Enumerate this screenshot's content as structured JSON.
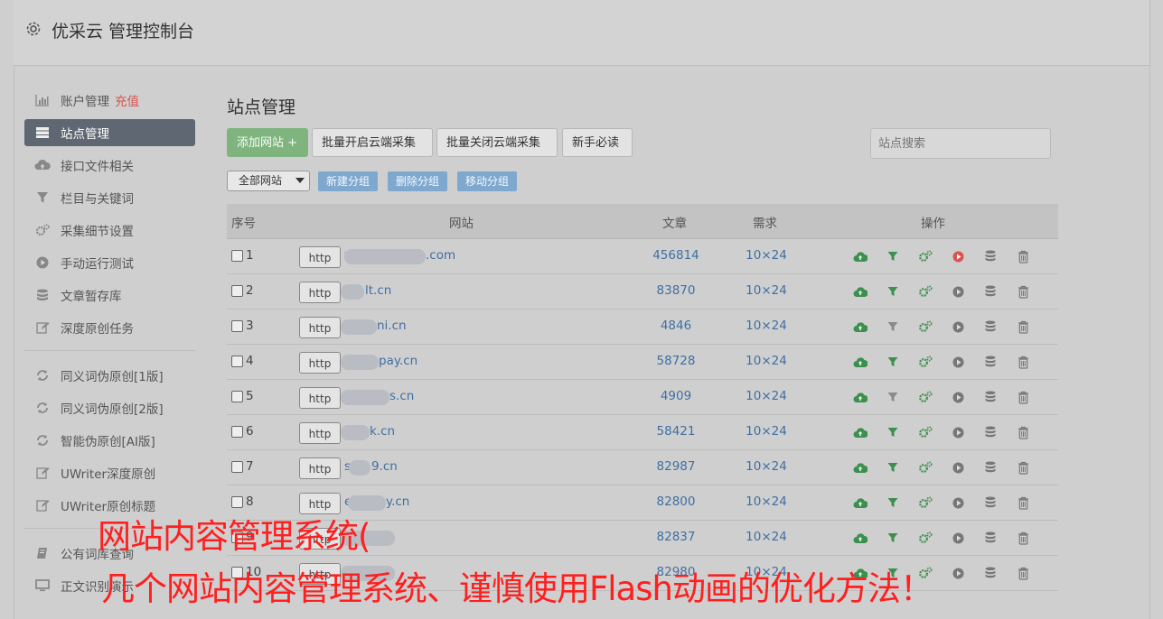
{
  "header": {
    "title": "优采云 管理控制台",
    "icon": "gear-icon"
  },
  "sidebar": {
    "items": [
      {
        "label": "账户管理",
        "extra": "充值",
        "icon": "bar-chart-icon",
        "active": false
      },
      {
        "label": "站点管理",
        "icon": "server-icon",
        "active": true
      },
      {
        "label": "接口文件相关",
        "icon": "cloud-upload-icon",
        "active": false
      },
      {
        "label": "栏目与关键词",
        "icon": "filter-icon",
        "active": false
      },
      {
        "label": "采集细节设置",
        "icon": "gears-icon",
        "active": false
      },
      {
        "label": "手动运行测试",
        "icon": "play-circle-icon",
        "active": false
      },
      {
        "label": "文章暂存库",
        "icon": "database-icon",
        "active": false
      },
      {
        "label": "深度原创任务",
        "icon": "edit-icon",
        "active": false
      }
    ],
    "items2": [
      {
        "label": "同义词伪原创[1版]",
        "icon": "refresh-icon"
      },
      {
        "label": "同义词伪原创[2版]",
        "icon": "refresh-icon"
      },
      {
        "label": "智能伪原创[AI版]",
        "icon": "refresh-icon"
      },
      {
        "label": "UWriter深度原创",
        "icon": "edit-icon"
      },
      {
        "label": "UWriter原创标题",
        "icon": "edit-icon"
      }
    ],
    "items3": [
      {
        "label": "公有词库查询",
        "icon": "book-icon"
      },
      {
        "label": "正文识别演示",
        "icon": "monitor-icon"
      }
    ]
  },
  "main": {
    "title": "站点管理",
    "buttons": {
      "add": "添加网站 +",
      "batch_open": "批量开启云端采集",
      "batch_close": "批量关闭云端采集",
      "guide": "新手必读"
    },
    "search_placeholder": "站点搜索",
    "group_select": "全部网站",
    "group_buttons": {
      "new": "新建分组",
      "delete": "删除分组",
      "move": "移动分组"
    },
    "table": {
      "headers": [
        "序号",
        "网站",
        "文章",
        "需求",
        "操作"
      ],
      "rows": [
        {
          "idx": "1",
          "protocol": "http",
          "prefix": "v",
          "domain": ".com",
          "articles": "456814",
          "demand": "10×24",
          "filter_active": true,
          "play_active": true
        },
        {
          "idx": "2",
          "protocol": "http",
          "prefix": "",
          "domain": "lt.cn",
          "articles": "83870",
          "demand": "10×24",
          "filter_active": true,
          "play_active": false
        },
        {
          "idx": "3",
          "protocol": "http",
          "prefix": "",
          "domain": "ni.cn",
          "articles": "4846",
          "demand": "10×24",
          "filter_active": false,
          "play_active": false
        },
        {
          "idx": "4",
          "protocol": "http",
          "prefix": "",
          "domain": "pay.cn",
          "articles": "58728",
          "demand": "10×24",
          "filter_active": true,
          "play_active": false
        },
        {
          "idx": "5",
          "protocol": "http",
          "prefix": "",
          "domain": "s.cn",
          "articles": "4909",
          "demand": "10×24",
          "filter_active": false,
          "play_active": false
        },
        {
          "idx": "6",
          "protocol": "http",
          "prefix": "",
          "domain": "k.cn",
          "articles": "58421",
          "demand": "10×24",
          "filter_active": true,
          "play_active": false
        },
        {
          "idx": "7",
          "protocol": "http",
          "prefix": "s",
          "domain": "9.cn",
          "articles": "82987",
          "demand": "10×24",
          "filter_active": true,
          "play_active": false
        },
        {
          "idx": "8",
          "protocol": "http",
          "prefix": "e",
          "domain": "y.cn",
          "articles": "82800",
          "demand": "10×24",
          "filter_active": true,
          "play_active": false
        },
        {
          "idx": "9",
          "protocol": "http",
          "prefix": "",
          "domain": "",
          "articles": "82837",
          "demand": "10×24",
          "filter_active": true,
          "play_active": false
        },
        {
          "idx": "10",
          "protocol": "http",
          "prefix": "",
          "domain": "",
          "articles": "82980",
          "demand": "10×24",
          "filter_active": true,
          "play_active": false
        }
      ]
    }
  },
  "overlay": {
    "line1": "网站内容管理系统(",
    "line2": "几个网站内容管理系统、谨慎使用Flash动画的优化方法！"
  },
  "colors": {
    "overlay_text": "#ff1f1f",
    "active_green": "#3c8f4d",
    "link_blue": "#3f6fa3",
    "play_red": "#d9534f"
  }
}
